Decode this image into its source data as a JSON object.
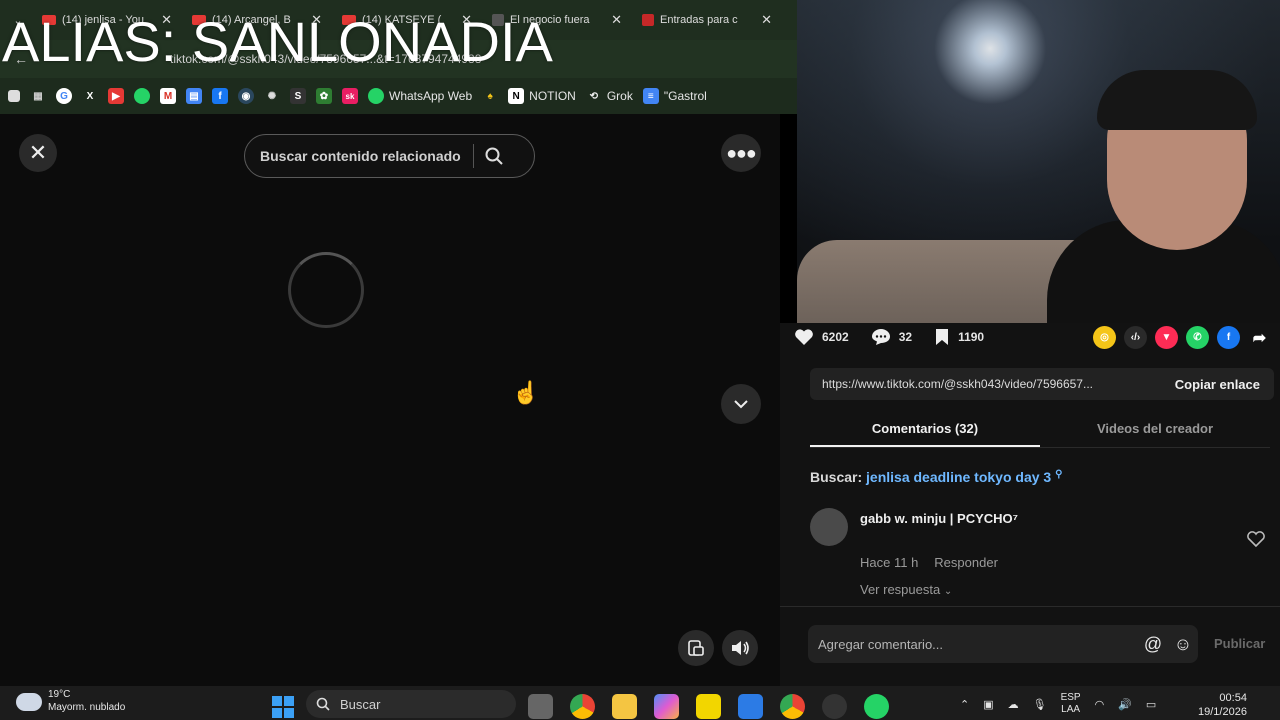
{
  "overlay": {
    "title": "ALIAS: SANLONADIA"
  },
  "browser": {
    "tabs": [
      {
        "label": "(14) jenlisa - You",
        "color": "#e53935"
      },
      {
        "label": "(14) Arcangel, B",
        "color": "#e53935"
      },
      {
        "label": "(14) KATSEYE (",
        "color": "#e53935"
      },
      {
        "label": "El negocio fuera",
        "color": "#555555"
      },
      {
        "label": "Entradas para c",
        "color": "#c62828"
      }
    ],
    "url": "tiktok.com/@sskh043/video/7596657...&t=1768794744988",
    "bookmarks": {
      "whatsapp": "WhatsApp Web",
      "notion": "NOTION",
      "grok": "Grok",
      "gastro": "\"Gastrol"
    }
  },
  "viewer": {
    "search_placeholder": "Buscar contenido relacionado"
  },
  "panel": {
    "likes": "6202",
    "comments": "32",
    "saves": "1190",
    "link": "https://www.tiktok.com/@sskh043/video/7596657...",
    "copy_label": "Copiar enlace",
    "tabs": [
      "Comentarios (32)",
      "Videos del creador"
    ],
    "related_prefix": "Buscar:",
    "related_query": "jenlisa deadline tokyo day 3",
    "comment": {
      "author": "gabb w. minju | PCYCHO⁷",
      "time": "Hace 11 h",
      "reply": "Responder",
      "see_replies": "Ver respuesta"
    },
    "comment_placeholder": "Agregar comentario...",
    "publish": "Publicar"
  },
  "taskbar": {
    "temp": "19°C",
    "weather": "Mayorm. nublado",
    "search": "Buscar",
    "lang1": "ESP",
    "lang2": "LAA",
    "time": "00:54",
    "date": "19/1/2026"
  }
}
